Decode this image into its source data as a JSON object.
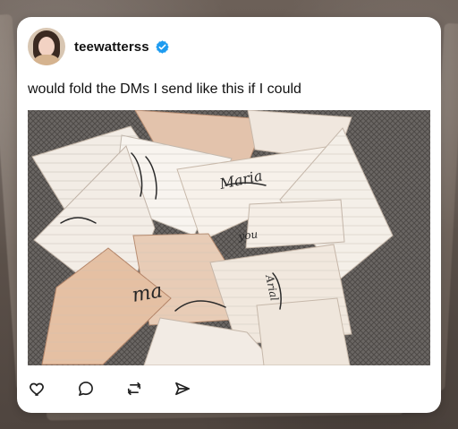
{
  "post": {
    "username": "teewatterss",
    "text": "would fold the DMs I send like this if I could"
  },
  "image_text": {
    "note_1": "Maria",
    "note_2": "ma",
    "note_3": "Arial",
    "note_4": "you"
  },
  "icons": {
    "verified": "verified-badge-icon",
    "like": "heart-icon",
    "comment": "comment-icon",
    "repost": "repost-icon",
    "share": "send-icon"
  },
  "colors": {
    "card_background": "#ffffff",
    "text_primary": "#111111",
    "verified_badge": "#1d9bf0"
  }
}
